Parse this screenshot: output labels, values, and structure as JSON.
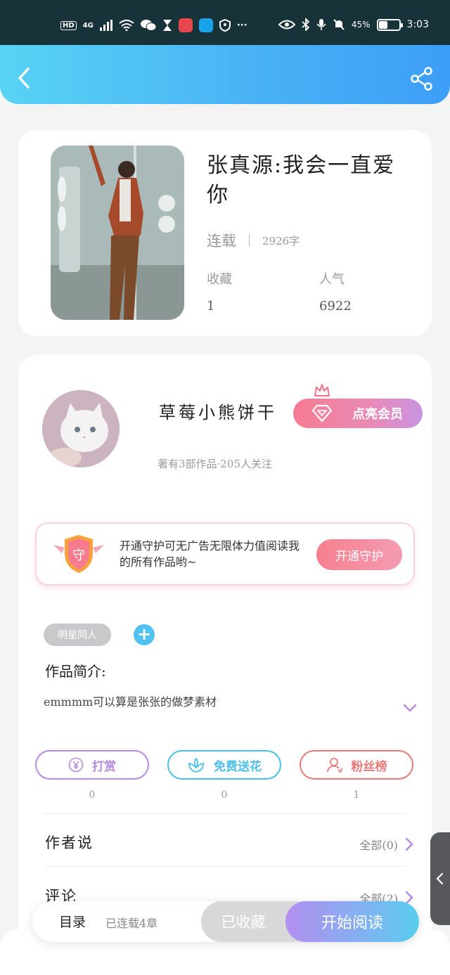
{
  "status_bar": {
    "hd": "HD",
    "network": "4G",
    "battery": "45%",
    "battery_level": 0.45,
    "time": "3:03",
    "more": "···"
  },
  "header": {
    "back_icon": "chevron-left-icon",
    "share_icon": "share-icon"
  },
  "book": {
    "title": "张真源:我会一直爱你",
    "status": "连载",
    "word_count": "2926字",
    "stats": [
      {
        "label": "收藏",
        "value": "1"
      },
      {
        "label": "人气",
        "value": "6922"
      }
    ]
  },
  "author": {
    "name": "草莓小熊饼干",
    "meta": "著有3部作品·205人关注",
    "vip_button": "点亮会员"
  },
  "guard": {
    "shield_text": "守",
    "text": "开通守护可无广告无限体力值阅读我的所有作品哟~",
    "button": "开通守护"
  },
  "tags": [
    "明星同人"
  ],
  "intro": {
    "title": "作品简介:",
    "text": "emmmm可以算是张张的做梦素材"
  },
  "actions": [
    {
      "label": "打赏",
      "count": "0",
      "icon": "yen-icon",
      "color": "#b58be0"
    },
    {
      "label": "免费送花",
      "count": "0",
      "icon": "flower-icon",
      "color": "#4bbfe9"
    },
    {
      "label": "粉丝榜",
      "count": "1",
      "icon": "user-icon",
      "color": "#e77b7b"
    }
  ],
  "sections": [
    {
      "label": "作者说",
      "right": "全部(0)"
    },
    {
      "label": "评论",
      "right": "全部(2)"
    }
  ],
  "bottom_bar": {
    "toc": "目录",
    "chapters": "已连载4章",
    "collected": "已收藏",
    "start_reading": "开始阅读"
  },
  "colors": {
    "header_start": "#58d3f5",
    "header_end": "#3d9ef7",
    "vip_start": "#f77b91",
    "vip_end": "#c893e2",
    "arrow": "#b58be0"
  }
}
